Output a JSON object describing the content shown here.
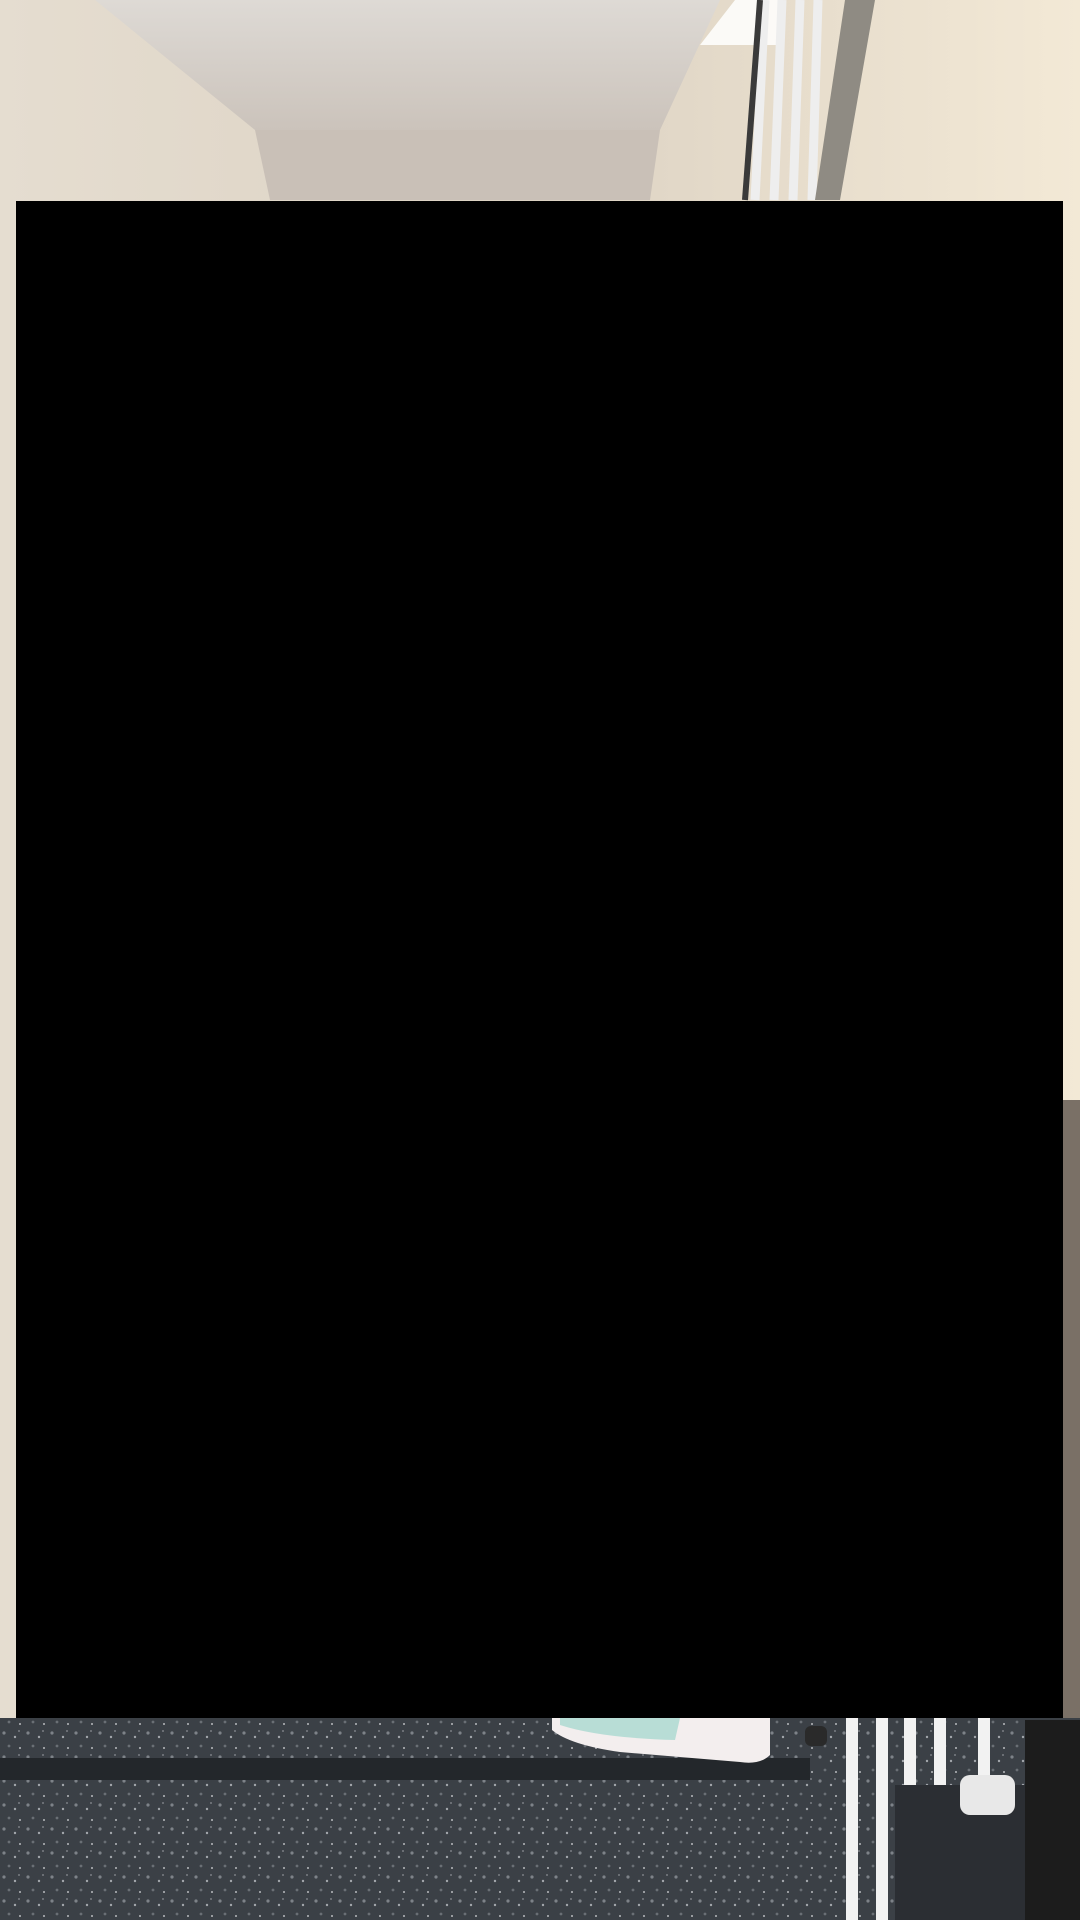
{
  "scene": {
    "description_icon": "photo-background",
    "colors": {
      "wall": "#e6dccc",
      "ceiling": "#d9d2c9",
      "floor": "#3a3f44",
      "railing": "#f2f2f2",
      "overlay": "#000000"
    }
  }
}
